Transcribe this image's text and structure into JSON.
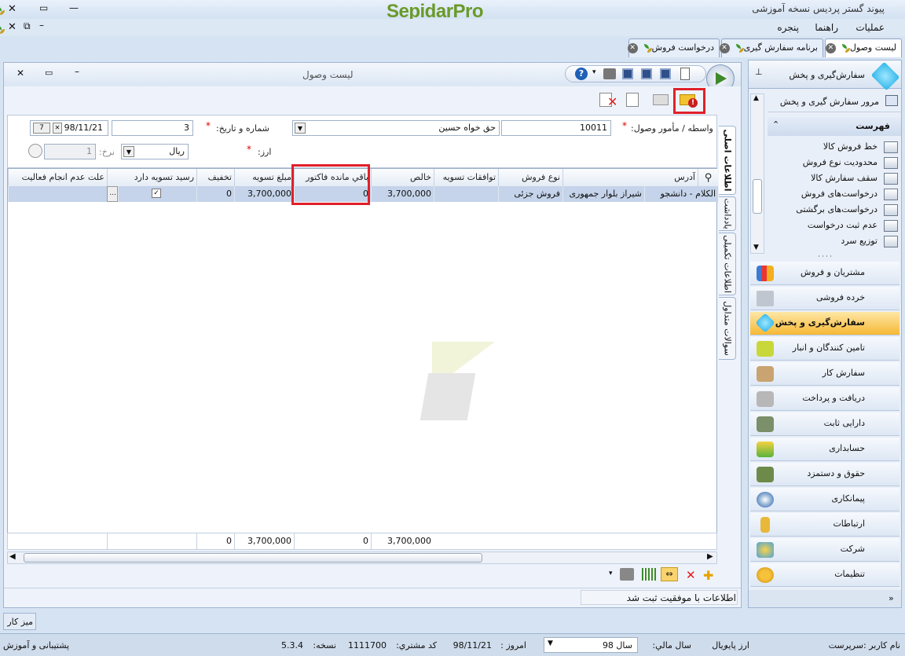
{
  "app": {
    "title": "پیوند گستر پردیس نسخه آموزشی",
    "brand": "SepidarPro",
    "window_min": "—",
    "window_restore": "▭",
    "window_close": "✕"
  },
  "menu": {
    "items": [
      "عملیات",
      "راهنما",
      "پنجره"
    ]
  },
  "tabs": [
    {
      "label": "لیست وصول",
      "active": true
    },
    {
      "label": "برنامه سفارش گیری",
      "active": false
    },
    {
      "label": "درخواست فروش",
      "active": false
    }
  ],
  "doc": {
    "title": "لیست وصول",
    "form": {
      "agent_label": "واسطه / مأمور وصول:",
      "agent_code": "10011",
      "agent_name": "حق خواه حسین",
      "number_label": "شماره و تاریخ:",
      "number": "3",
      "date": "98/11/21",
      "currency_label": "ارز:",
      "currency": "ریال",
      "rate_label": "نرخ:",
      "rate": "1"
    },
    "grid": {
      "columns": [
        "آدرس",
        "نوع فروش",
        "توافقات تسویه",
        "خالص",
        "باقي مانده فاكتور",
        "مبلغ تسويه",
        "تخفیف",
        "رسید تسویه دارد",
        "علت عدم انجام فعالیت"
      ],
      "rows": [
        {
          "customer": "الکلام - دانشجو",
          "address": "شیراز بلوار جمهوری",
          "sale_type": "فروش جزئی",
          "agreements": "",
          "net": "3,700,000",
          "remaining": "0",
          "settlement": "3,700,000",
          "discount": "0",
          "has_receipt": "✓",
          "reason": "..."
        }
      ],
      "totals": {
        "net": "3,700,000",
        "remaining": "0",
        "settlement": "3,700,000",
        "discount": "0"
      }
    },
    "side_tabs": [
      "اطلاعات اصلی",
      "یادداشت",
      "اطلاعات تکمیلی",
      "سوالات متداول"
    ],
    "status_message": "اطلاعات با موفقیت ثبت شد"
  },
  "nav": {
    "header": "سفارش‌گیری و پخش",
    "overview": "مرور سفارش گیری و پخش",
    "list_title": "فهرست",
    "tree": [
      "خط فروش کالا",
      "محدودیت نوع فروش",
      "سقف سفارش کالا",
      "درخواست‌های فروش",
      "درخواست‌های برگشتی",
      "عدم ثبت درخواست",
      "توزیع سرد"
    ],
    "modules": [
      "مشتریان و فروش",
      "خرده فروشی",
      "سفارش‌گیری و پخش",
      "تامین کنندگان و انبار",
      "سفارش کار",
      "دریافت و پرداخت",
      "دارایی ثابت",
      "حسابداری",
      "حقوق و دستمزد",
      "پیمانکاری",
      "ارتباطات",
      "شرکت",
      "تنظیمات"
    ],
    "active_index": 2
  },
  "desk": "میز کار",
  "statusbar": {
    "user_label": "نام کاربر :",
    "user": "سرپرست",
    "base_currency_label": "ارز پایه :",
    "base_currency": "ریال",
    "fiscal_label": "سال مالي:",
    "fiscal": "سال 98",
    "today_label": "امروز :",
    "today": "98/11/21",
    "customer_code_label": "كد مشتري:",
    "customer_code": "1111700",
    "version_label": "نسخه:",
    "version": "5.3.4",
    "support": "پشتیبانی و آموزش"
  }
}
